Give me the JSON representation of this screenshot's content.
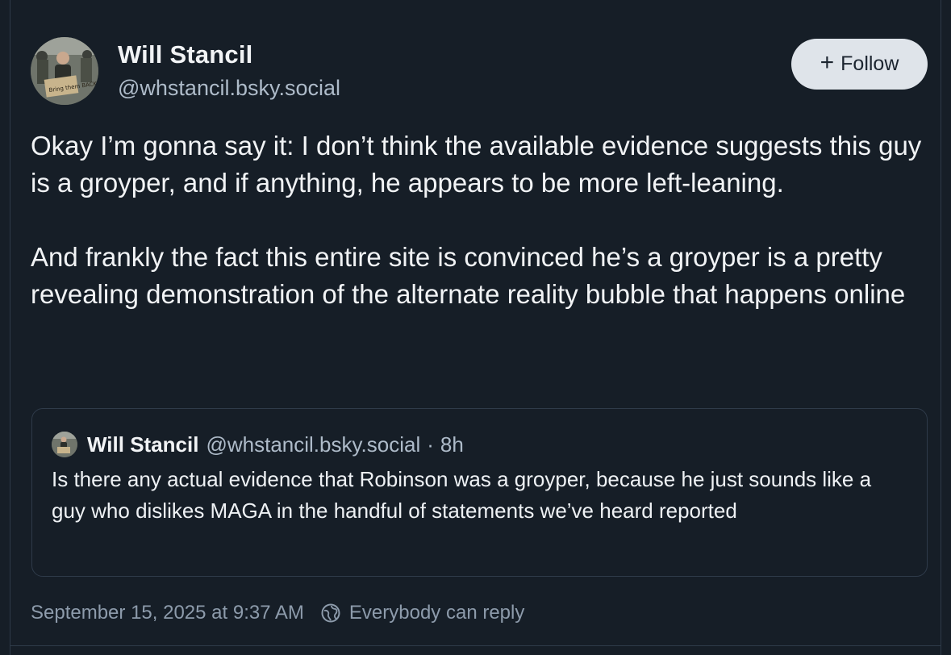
{
  "author": {
    "name": "Will Stancil",
    "handle": "@whstancil.bsky.social",
    "avatar_icon": "protest-photo-avatar",
    "sign_text": "Bring them BACK!"
  },
  "follow_button": {
    "icon": "plus-icon",
    "plus": "+",
    "label": "Follow"
  },
  "post": {
    "paragraphs": [
      "Okay I’m gonna say it: I don’t think the available evidence suggests this guy is a groyper, and if anything, he appears to be more left-leaning.",
      "And frankly the fact this entire site is convinced he’s a groyper is a pretty revealing demonstration of the alternate reality bubble that happens online"
    ]
  },
  "quote": {
    "name": "Will Stancil",
    "handle": "@whstancil.bsky.social",
    "separator": "·",
    "time": "8h",
    "text": "Is there any actual evidence that Robinson was a groyper, because he just sounds like a guy who dislikes MAGA in the handful of statements we’ve heard reported"
  },
  "footer": {
    "timestamp": "September 15, 2025 at 9:37 AM",
    "reply_icon": "globe-icon",
    "reply_setting": "Everybody can reply"
  },
  "colors": {
    "background": "#161e27",
    "text": "#f1f3f5",
    "muted": "#aebbc9",
    "button_bg": "#dfe4ea",
    "border": "#2e3a48"
  }
}
